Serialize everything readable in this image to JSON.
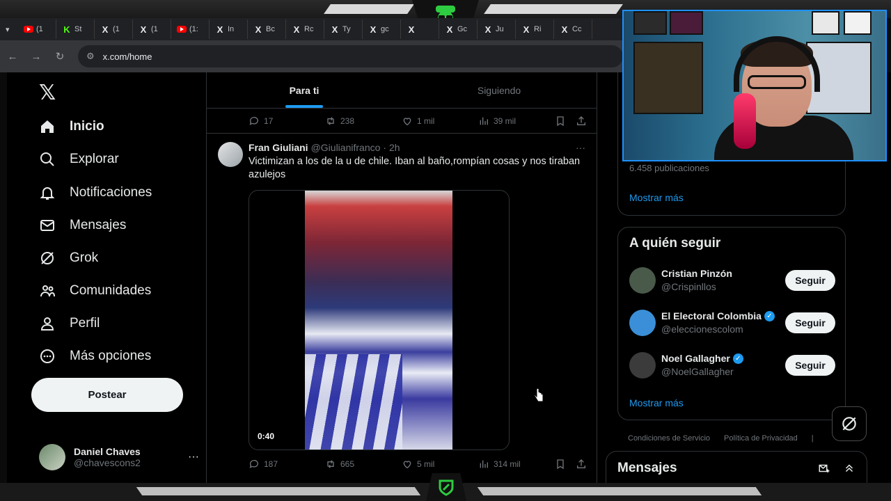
{
  "browser": {
    "tabs": [
      {
        "icon": "youtube-icon",
        "label": "(1"
      },
      {
        "icon": "kick-icon",
        "label": "St"
      },
      {
        "icon": "x-logo-icon",
        "label": "(1"
      },
      {
        "icon": "x-logo-icon",
        "label": "(1"
      },
      {
        "icon": "youtube-icon",
        "label": "(1:"
      },
      {
        "icon": "x-logo-icon",
        "label": "In"
      },
      {
        "icon": "x-logo-icon",
        "label": "Bc"
      },
      {
        "icon": "x-logo-icon",
        "label": "Rc"
      },
      {
        "icon": "x-logo-icon",
        "label": "Ty"
      },
      {
        "icon": "x-logo-icon",
        "label": "gc"
      },
      {
        "icon": "x-logo-icon",
        "label": ""
      },
      {
        "icon": "x-logo-icon",
        "label": "Gc"
      },
      {
        "icon": "x-logo-icon",
        "label": "Ju"
      },
      {
        "icon": "x-logo-icon",
        "label": "Ri"
      },
      {
        "icon": "x-logo-icon",
        "label": "Cc"
      }
    ],
    "url": "x.com/home"
  },
  "nav": {
    "items": [
      {
        "id": "inicio",
        "icon": "home-icon",
        "label": "Inicio",
        "active": true
      },
      {
        "id": "explorar",
        "icon": "search-icon",
        "label": "Explorar"
      },
      {
        "id": "notificaciones",
        "icon": "bell-icon",
        "label": "Notificaciones"
      },
      {
        "id": "mensajes",
        "icon": "mail-icon",
        "label": "Mensajes"
      },
      {
        "id": "grok",
        "icon": "grok-icon",
        "label": "Grok"
      },
      {
        "id": "comunidades",
        "icon": "people-icon",
        "label": "Comunidades"
      },
      {
        "id": "perfil",
        "icon": "person-icon",
        "label": "Perfil"
      },
      {
        "id": "mas",
        "icon": "more-circle-icon",
        "label": "Más opciones"
      }
    ],
    "post_label": "Postear",
    "profile": {
      "name": "Daniel Chaves",
      "handle": "@chavescons2"
    }
  },
  "feed": {
    "tabs": [
      "Para ti",
      "Siguiendo"
    ],
    "prev_actions": {
      "replies": "17",
      "reposts": "238",
      "likes": "1 mil",
      "views": "39 mil"
    },
    "tweet": {
      "name": "Fran Giuliani",
      "handle": "@Giulianifranco",
      "time": "· 2h",
      "text": "Victimizan a los de la u de chile. Iban al baño,rompían cosas y nos tiraban azulejos",
      "video_duration": "0:40",
      "actions": {
        "replies": "187",
        "reposts": "665",
        "likes": "5 mil",
        "views": "314 mil"
      }
    }
  },
  "right": {
    "pub_count": "6.458 publicaciones",
    "show_more": "Mostrar más",
    "who_to_follow": {
      "title": "A quién seguir",
      "users": [
        {
          "name": "Cristian Pinzón",
          "handle": "@Crispinllos",
          "verified": false,
          "color": "#4a5a4a"
        },
        {
          "name": "El Electoral Colombia",
          "handle": "@eleccionescolom",
          "verified": true,
          "color": "#3a8fd8"
        },
        {
          "name": "Noel Gallagher",
          "handle": "@NoelGallagher",
          "verified": true,
          "color": "#3b3b3b"
        }
      ],
      "follow_label": "Seguir",
      "show_more": "Mostrar más"
    },
    "footer": [
      "Condiciones de Servicio",
      "Política de Privacidad",
      "|"
    ],
    "messages_title": "Mensajes"
  },
  "colors": {
    "accent": "#1d9bf0",
    "bg": "#000000",
    "text": "#e7e9ea",
    "muted": "#71767b"
  }
}
